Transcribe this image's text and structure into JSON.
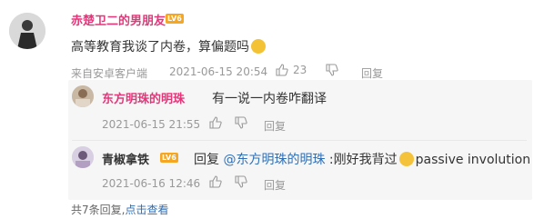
{
  "comment": {
    "username": "赤楚卫二的男朋友",
    "level": "LV6",
    "text": "高等教育我谈了内卷，算偏题吗",
    "source": "来自安卓客户端",
    "time": "2021-06-15 20:54",
    "likes": "23",
    "reply_label": "回复",
    "colors": {
      "username": "#e5367a",
      "level_badge": "#f5a623"
    }
  },
  "replies": [
    {
      "username": "东方明珠的明珠",
      "text": "有一说一内卷咋翻译",
      "time": "2021-06-15 21:55",
      "reply_label": "回复",
      "colors": {
        "username": "#e5367a"
      }
    },
    {
      "username": "青椒拿铁",
      "level": "LV6",
      "prefix": "回复 ",
      "mention": "@东方明珠的明珠",
      "text_before_emoji": " :刚好我背过",
      "text_after_emoji": "passive involution",
      "time": "2021-06-16 12:46",
      "reply_label": "回复",
      "colors": {
        "username": "#333333",
        "level_badge": "#f5a623",
        "mention": "#2f6fb6"
      }
    }
  ],
  "footer": {
    "count_text": "共7条回复,",
    "expand_link": "点击查看"
  },
  "icons": [
    "like-icon",
    "dislike-icon",
    "emoji-icon"
  ]
}
